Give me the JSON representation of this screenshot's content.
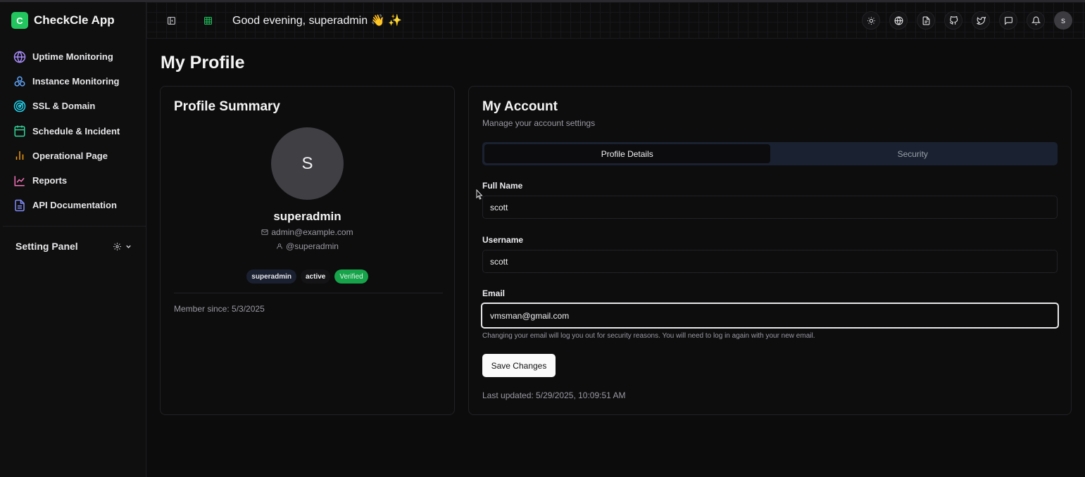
{
  "app": {
    "logo_letter": "C",
    "name": "CheckCle App"
  },
  "sidebar": {
    "items": [
      {
        "label": "Uptime Monitoring",
        "icon": "globe-icon",
        "color": "#a78bfa"
      },
      {
        "label": "Instance Monitoring",
        "icon": "network-icon",
        "color": "#60a5fa"
      },
      {
        "label": "SSL & Domain",
        "icon": "radar-icon",
        "color": "#22d3ee"
      },
      {
        "label": "Schedule & Incident",
        "icon": "calendar-icon",
        "color": "#34d399"
      },
      {
        "label": "Operational Page",
        "icon": "bar-chart-icon",
        "color": "#f59e0b"
      },
      {
        "label": "Reports",
        "icon": "line-chart-icon",
        "color": "#f472b6"
      },
      {
        "label": "API Documentation",
        "icon": "document-icon",
        "color": "#818cf8"
      }
    ],
    "setting_panel": "Setting Panel"
  },
  "header": {
    "greeting": "Good evening, superadmin 👋 ✨",
    "user_initial": "s",
    "actions": [
      "sun-icon",
      "globe-icon",
      "file-icon",
      "github-icon",
      "twitter-icon",
      "message-icon",
      "bell-icon"
    ]
  },
  "page": {
    "title": "My Profile"
  },
  "profile_summary": {
    "title": "Profile Summary",
    "avatar_initial": "S",
    "name": "superadmin",
    "email": "admin@example.com",
    "handle": "@superadmin",
    "badges": {
      "role": "superadmin",
      "status": "active",
      "verified": "Verified"
    },
    "member_since": "Member since: 5/3/2025"
  },
  "account": {
    "title": "My Account",
    "subtitle": "Manage your account settings",
    "tabs": [
      "Profile Details",
      "Security"
    ],
    "active_tab": "Profile Details",
    "fields": {
      "full_name": {
        "label": "Full Name",
        "value": "scott"
      },
      "username": {
        "label": "Username",
        "value": "scott"
      },
      "email": {
        "label": "Email",
        "value": "vmsman@gmail.com"
      }
    },
    "email_hint": "Changing your email will log you out for security reasons. You will need to log in again with your new email.",
    "save_label": "Save Changes",
    "last_updated": "Last updated: 5/29/2025, 10:09:51 AM"
  },
  "colors": {
    "brand": "#22c55e",
    "verified": "#16a34a",
    "background": "#0c0c0d"
  }
}
